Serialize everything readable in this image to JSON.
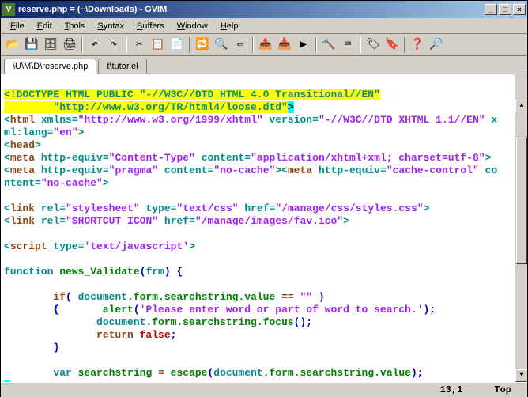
{
  "window": {
    "title": "reserve.php = (~\\Downloads) - GVIM"
  },
  "menu": {
    "file": "File",
    "edit": "Edit",
    "tools": "Tools",
    "syntax": "Syntax",
    "buffers": "Buffers",
    "window": "Window",
    "help": "Help"
  },
  "tabs": {
    "tab1": "\\U\\M\\D\\reserve.php",
    "tab2": "t\\tutor.el"
  },
  "code": {
    "l1a": "<!DOCTYPE HTML PUBLIC \"-//W3C//DTD HTML 4.0 Transitional//EN\"",
    "l2a": "        \"http://www.w3.org/TR/html4/loose.dtd\"",
    "l2b": ">",
    "l3a": "<",
    "l3b": "html",
    "l3c": " xmlns",
    "l3d": "=",
    "l3e": "\"http://www.w3.org/1999/xhtml\"",
    "l3f": " version",
    "l3g": "=",
    "l3h": "\"-//W3C//DTD XHTML 1.1//EN\"",
    "l3i": " x",
    "l4a": "ml:lang",
    "l4b": "=",
    "l4c": "\"en\"",
    "l4d": ">",
    "l5a": "<",
    "l5b": "head",
    "l5c": ">",
    "l6a": "<",
    "l6b": "meta",
    "l6c": " http-equiv",
    "l6d": "=",
    "l6e": "\"Content-Type\"",
    "l6f": " content",
    "l6g": "=",
    "l6h": "\"application/xhtml+xml; charset=utf-8\"",
    "l6i": ">",
    "l7a": "<",
    "l7b": "meta",
    "l7c": " http-equiv",
    "l7d": "=",
    "l7e": "\"pragma\"",
    "l7f": " content",
    "l7g": "=",
    "l7h": "\"no-cache\"",
    "l7i": "><",
    "l7j": "meta",
    "l7k": " http-equiv",
    "l7l": "=",
    "l7m": "\"cache-control\"",
    "l7n": " co",
    "l8a": "ntent",
    "l8b": "=",
    "l8c": "\"no-cache\"",
    "l8d": ">",
    "l10a": "<",
    "l10b": "link",
    "l10c": " rel",
    "l10d": "=",
    "l10e": "\"stylesheet\"",
    "l10f": " type",
    "l10g": "=",
    "l10h": "\"text/css\"",
    "l10i": " href",
    "l10j": "=",
    "l10k": "\"/manage/css/styles.css\"",
    "l10l": ">",
    "l11a": "<",
    "l11b": "link",
    "l11c": " rel",
    "l11d": "=",
    "l11e": "\"SHORTCUT ICON\"",
    "l11f": " href",
    "l11g": "=",
    "l11h": "\"/manage/images/fav.ico\"",
    "l11i": ">",
    "l13a": "<",
    "l13b": "script",
    "l13c": " type",
    "l13d": "=",
    "l13e": "'text/javascript'",
    "l13f": ">",
    "l15a": "function",
    "l15b": " news_Validate",
    "l15c": "(",
    "l15d": "frm",
    "l15e": ") {",
    "l17a": "        if",
    "l17b": "(",
    "l17c": " document",
    "l17d": ".form.searchstring.value ",
    "l17e": "==",
    "l17f": " \"\"",
    "l17g": " )",
    "l18a": "        {",
    "l18b": "       alert",
    "l18c": "(",
    "l18d": "'Please enter word or part of word to search.'",
    "l18e": ");",
    "l19a": "               document",
    "l19b": ".form.searchstring.focus",
    "l19c": "();",
    "l20a": "               return",
    "l20b": " false",
    "l20c": ";",
    "l21a": "        }",
    "l23a": "        var",
    "l23b": " searchstring ",
    "l23c": "=",
    "l23d": " escape",
    "l23e": "(",
    "l23f": "document",
    "l23g": ".form.searchstring.value",
    "l23h": ");",
    "l24a": "e"
  },
  "status": {
    "pos": "13,1",
    "scroll": "Top"
  }
}
